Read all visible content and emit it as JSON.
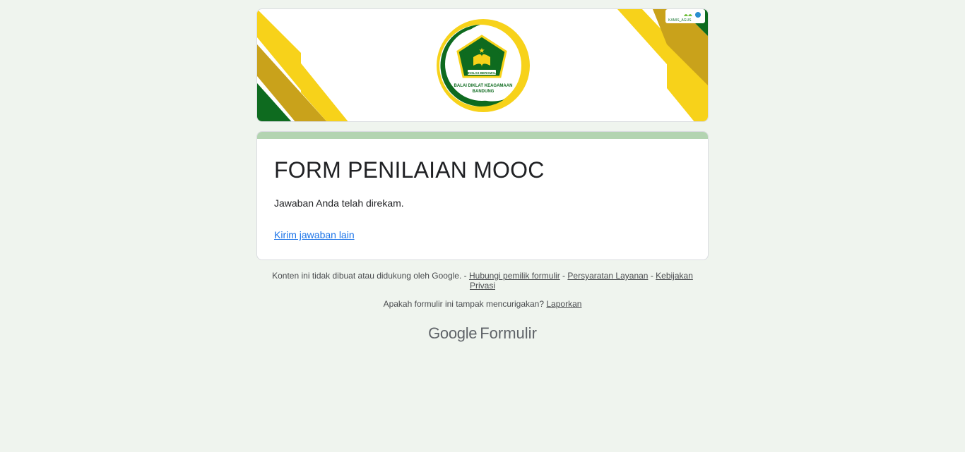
{
  "banner": {
    "logo_caption_line1": "BALAI DIKLAT KEAGAMAAN",
    "logo_caption_line2": "BANDUNG",
    "logo_ribbon": "IKHLAS BERAMAL",
    "corner_badge": "KAMIS_AGUS",
    "colors": {
      "green": "#0e6b1f",
      "gold": "#c9a21b",
      "yellow": "#f7d21a"
    }
  },
  "form": {
    "title": "FORM PENILAIAN MOOC",
    "confirmation": "Jawaban Anda telah direkam.",
    "another_response_link": "Kirim jawaban lain",
    "accent_color": "#b3d4b1"
  },
  "footer": {
    "disclaimer": "Konten ini tidak dibuat atau didukung oleh Google. -",
    "link_contact_owner": "Hubungi pemilik formulir",
    "sep1": "-",
    "link_terms": "Persyaratan Layanan",
    "sep2": "-",
    "link_privacy": "Kebijakan Privasi",
    "suspicious_question": "Apakah formulir ini tampak mencurigakan?",
    "link_report": "Laporkan"
  },
  "brand": {
    "google": "Google",
    "product": "Formulir"
  }
}
